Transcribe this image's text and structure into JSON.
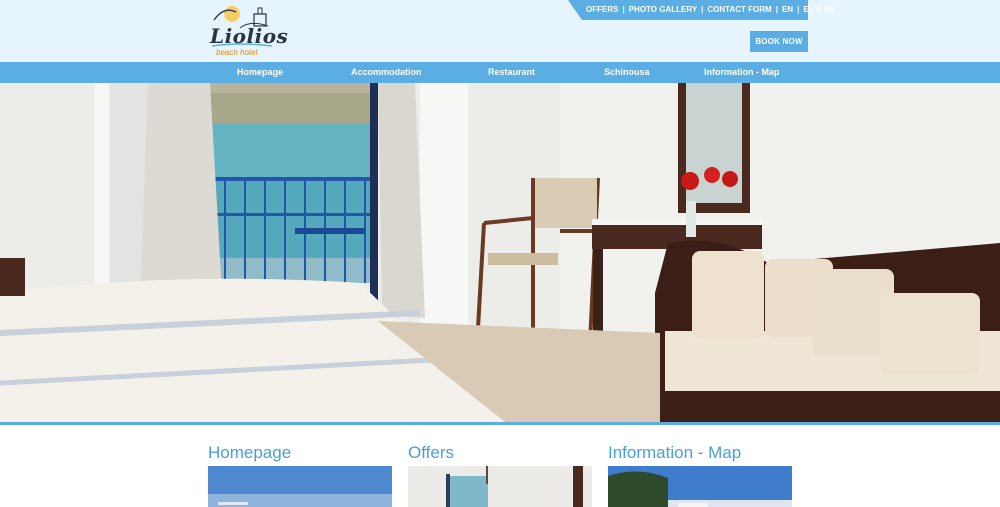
{
  "logo": {
    "name": "Liolios",
    "subtitle": "beach hotel"
  },
  "top_nav": [
    "OFFERS",
    "PHOTO GALLERY",
    "CONTACT FORM",
    "EN",
    "EL",
    "FR"
  ],
  "book_button": "BOOK NOW",
  "main_nav": [
    "Homepage",
    "Accommodation",
    "Restaurant",
    "Schinousa",
    "Information - Map"
  ],
  "slider": {
    "total_slides": 9,
    "active_slide": 1
  },
  "boxes": [
    "Homepage",
    "Offers",
    "Information - Map"
  ],
  "colors": {
    "accent": "#5aaee3",
    "header_bg": "#e6f5fd",
    "title": "#4a9fd8"
  }
}
